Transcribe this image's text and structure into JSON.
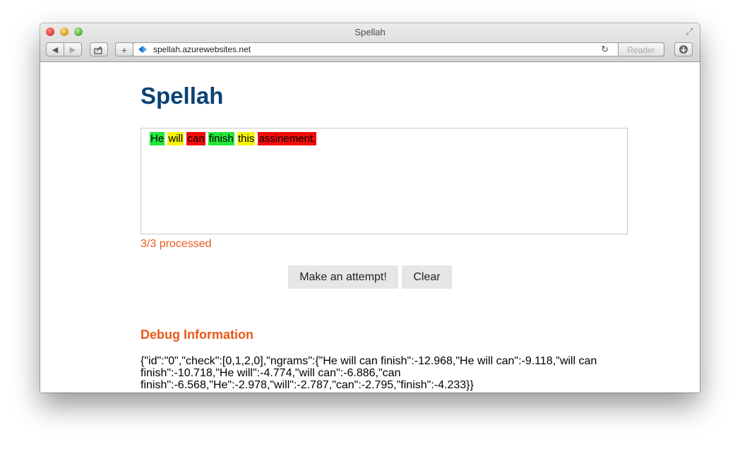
{
  "window": {
    "title": "Spellah",
    "address": "spellah.azurewebsites.net",
    "reader_label": "Reader"
  },
  "page": {
    "title": "Spellah",
    "words": [
      {
        "text": "He",
        "status": "green"
      },
      {
        "text": "will",
        "status": "yellow"
      },
      {
        "text": "can",
        "status": "red"
      },
      {
        "text": "finish",
        "status": "green"
      },
      {
        "text": "this",
        "status": "yellow"
      },
      {
        "text": "assinement.",
        "status": "red"
      }
    ],
    "highlight_colors": {
      "green": "#23e63a",
      "yellow": "#f6f20a",
      "red": "#f40b0b"
    },
    "status": "3/3 processed",
    "attempt_label": "Make an attempt!",
    "clear_label": "Clear",
    "debug_heading": "Debug Information",
    "debug_lines": [
      "{\"id\":\"0\",\"check\":[0,1,2,0],\"ngrams\":{\"He will can finish\":-12.968,\"He will can\":-9.118,\"will can",
      "finish\":-10.718,\"He will\":-4.774,\"will can\":-6.886,\"can",
      "finish\":-6.568,\"He\":-2.978,\"will\":-2.787,\"can\":-2.795,\"finish\":-4.233}}"
    ]
  },
  "colors": {
    "title": "#0a4275",
    "accent": "#e85a1a"
  }
}
